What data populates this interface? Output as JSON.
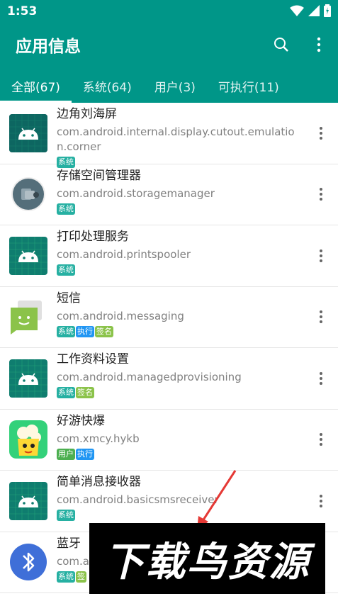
{
  "status_bar": {
    "time": "1:53"
  },
  "toolbar": {
    "title": "应用信息"
  },
  "tabs": [
    {
      "label": "全部(67)",
      "active": true
    },
    {
      "label": "系统(64)"
    },
    {
      "label": "用户(3)"
    },
    {
      "label": "可执行(11)"
    }
  ],
  "apps": [
    {
      "name": "边角刘海屏",
      "package": "com.android.internal.display.cutout.emulation.corner",
      "tags": [
        "系统"
      ],
      "icon": "android-icon"
    },
    {
      "name": "存储空间管理器",
      "package": "com.android.storagemanager",
      "tags": [
        "系统"
      ],
      "icon": "storage-manager-icon"
    },
    {
      "name": "打印处理服务",
      "package": "com.android.printspooler",
      "tags": [
        "系统"
      ],
      "icon": "android-icon"
    },
    {
      "name": "短信",
      "package": "com.android.messaging",
      "tags": [
        "系统",
        "执行",
        "签名"
      ],
      "icon": "messaging-icon"
    },
    {
      "name": "工作资料设置",
      "package": "com.android.managedprovisioning",
      "tags": [
        "系统",
        "签名"
      ],
      "icon": "android-icon"
    },
    {
      "name": "好游快爆",
      "package": "com.xmcy.hykb",
      "tags": [
        "用户",
        "执行"
      ],
      "icon": "hykb-icon"
    },
    {
      "name": "简单消息接收器",
      "package": "com.android.basicsmsreceiver",
      "tags": [
        "系统"
      ],
      "icon": "android-icon"
    },
    {
      "name": "蓝牙",
      "package": "com.a",
      "tags": [
        "系统",
        "签"
      ],
      "icon": "bluetooth-icon"
    }
  ],
  "watermark": {
    "text": "下载鸟资源"
  },
  "colors": {
    "primary": "#009688",
    "tag_system": "#26b0a2",
    "tag_exec": "#2196f3",
    "tag_sign": "#8bc34a",
    "tag_user": "#4caf50"
  }
}
